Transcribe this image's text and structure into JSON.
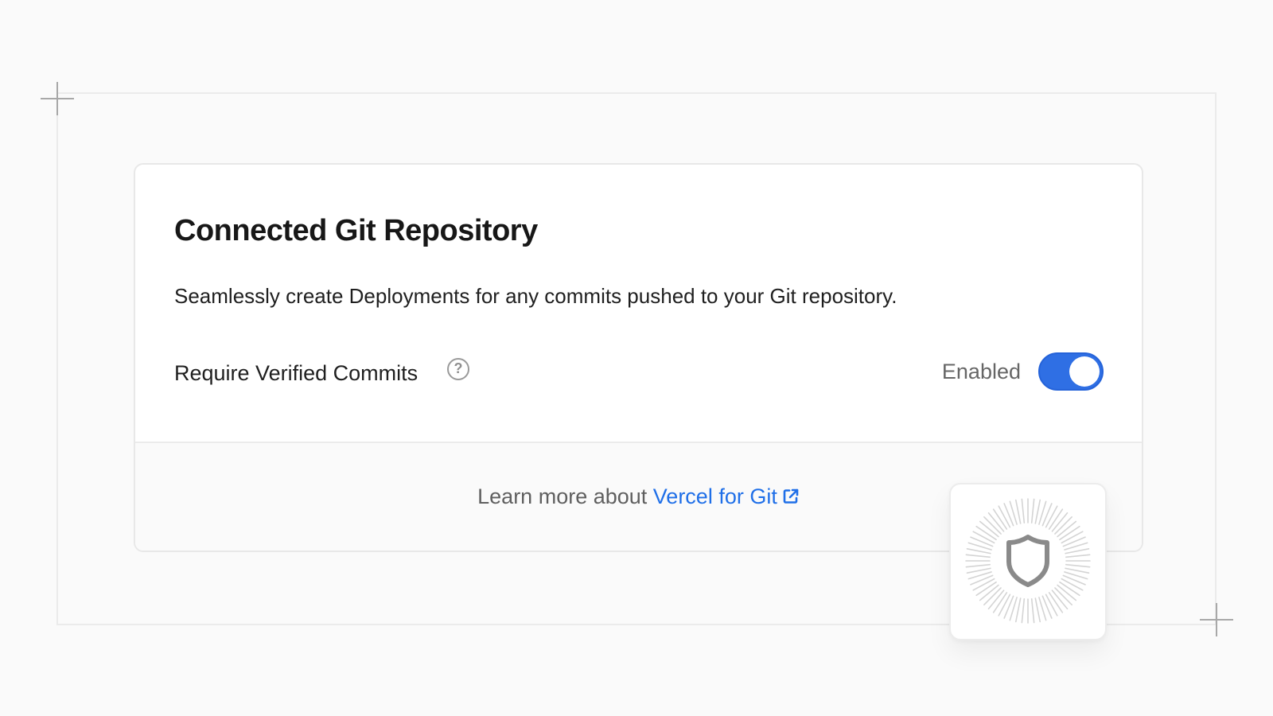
{
  "card": {
    "title": "Connected Git Repository",
    "description": "Seamlessly create Deployments for any commits pushed to your Git repository.",
    "setting": {
      "label": "Require Verified Commits",
      "help_icon": "question-circle-icon",
      "status": "Enabled",
      "enabled": true
    },
    "footer": {
      "prefix": "Learn more about ",
      "link_text": "Vercel for Git",
      "link_icon": "external-link-icon"
    }
  },
  "badge": {
    "icon": "shield-icon"
  },
  "colors": {
    "accent": "#2f6fe4",
    "link": "#1f6fe8",
    "background": "#fafafa"
  }
}
